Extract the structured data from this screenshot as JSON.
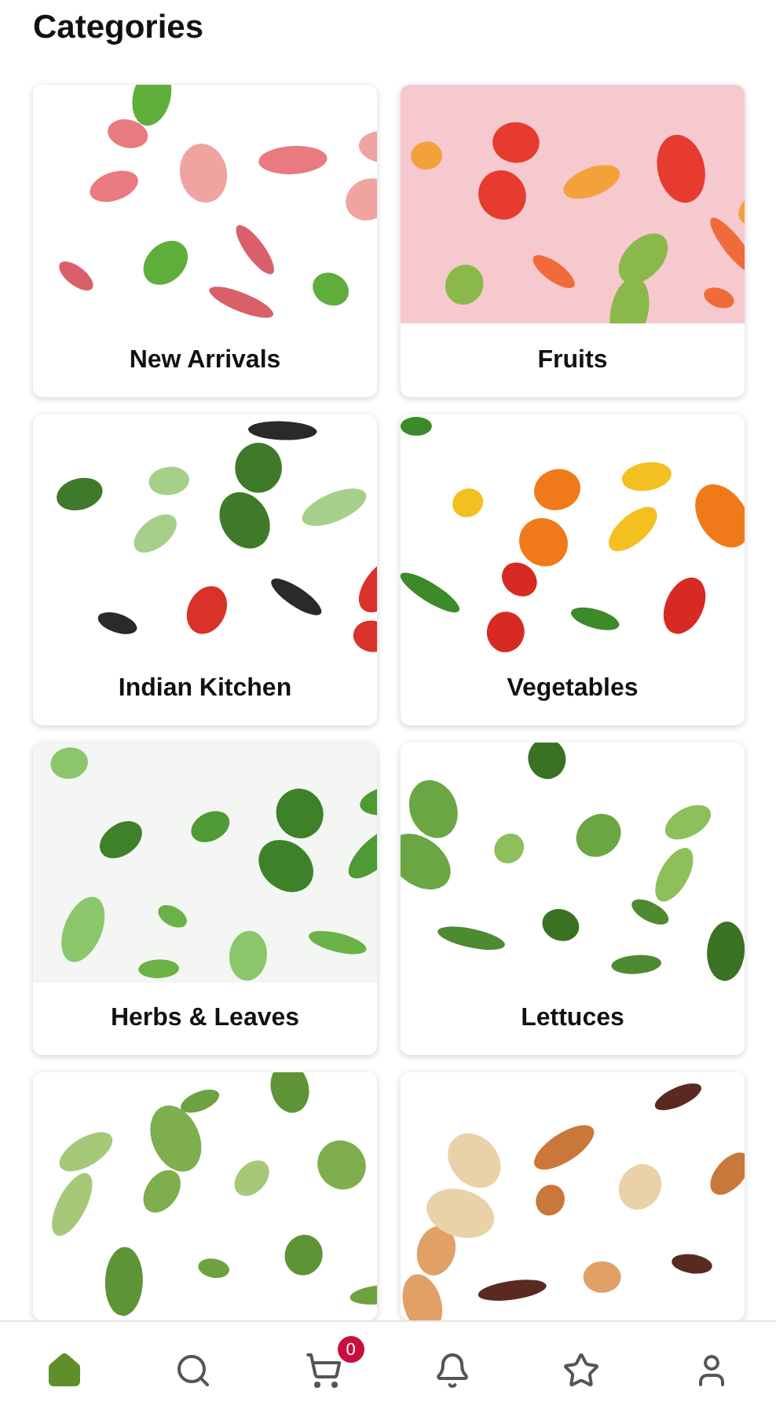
{
  "title": "Categories",
  "categories": [
    {
      "label": "New Arrivals",
      "kind": "picture"
    },
    {
      "label": "Fruits",
      "kind": "picture"
    },
    {
      "label": "Indian Kitchen",
      "kind": "picture"
    },
    {
      "label": "Vegetables",
      "kind": "picture"
    },
    {
      "label": "Herbs & Leaves",
      "kind": "picture"
    },
    {
      "label": "Lettuces",
      "kind": "picture"
    },
    {
      "kind": "picture"
    },
    {
      "kind": "picture"
    }
  ],
  "nav": [
    {
      "kind": "home",
      "selected": true
    },
    {
      "kind": "search",
      "selected": false
    },
    {
      "kind": "cart",
      "selected": false,
      "badge": "0"
    },
    {
      "kind": "bell",
      "selected": false
    },
    {
      "kind": "star",
      "selected": false
    },
    {
      "kind": "user",
      "selected": false
    }
  ]
}
